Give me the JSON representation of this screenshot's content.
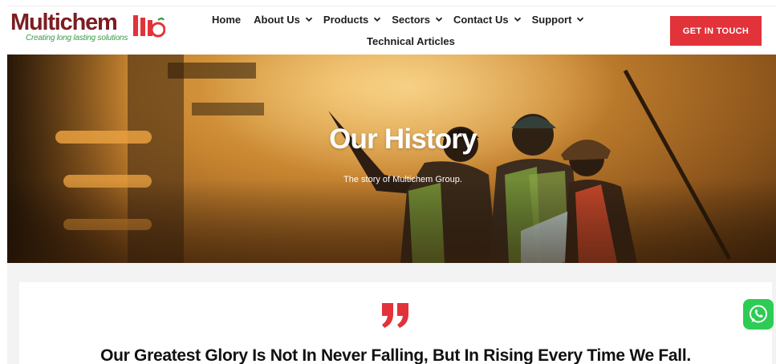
{
  "brand": {
    "name": "Multichem",
    "tagline": "Creating long lasting solutions",
    "colors": {
      "primary": "#7c1d21",
      "accent": "#e2323a",
      "tagline": "#3a9b48"
    }
  },
  "nav": {
    "items": [
      {
        "label": "Home",
        "has_dropdown": false
      },
      {
        "label": "About Us",
        "has_dropdown": true
      },
      {
        "label": "Products",
        "has_dropdown": true
      },
      {
        "label": "Sectors",
        "has_dropdown": true
      },
      {
        "label": "Contact Us",
        "has_dropdown": true
      },
      {
        "label": "Support",
        "has_dropdown": true
      }
    ],
    "second_row": "Technical Articles",
    "cta": "GET IN TOUCH"
  },
  "hero": {
    "title": "Our History",
    "subtitle": "The story of Multichem Group."
  },
  "quote": {
    "icon": "quote-icon",
    "text": "Our Greatest Glory Is Not In Never Falling, But In Rising Every Time We Fall."
  },
  "floating": {
    "icon": "whatsapp-icon",
    "color": "#2ecc54"
  }
}
